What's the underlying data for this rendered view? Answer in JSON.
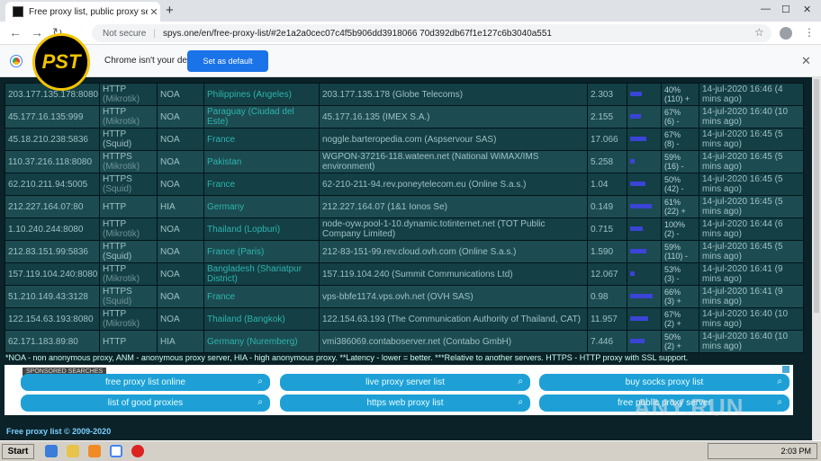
{
  "browser": {
    "tab_title": "Free proxy list, public proxy servers",
    "address": {
      "security": "Not secure",
      "url": "spys.one/en/free-proxy-list/#2e1a2a0cec07c4f5b906dd3918066 70d392db67f1e127c6b3040a551"
    },
    "infobar": {
      "message": "Chrome isn't your default browser",
      "set_default_label": "Set as default"
    }
  },
  "logo_text": "PST",
  "proxies": [
    {
      "ip": "203.177.135.178:8080",
      "type": "HTTP",
      "type_sub": "(Mikrotik)",
      "anon": "NOA",
      "country": "Philippines (Angeles)",
      "host": "203.177.135.178 (Globe Telecoms)",
      "latency": "2.303",
      "uptime": "40%",
      "uptime_sub": "(110) +",
      "checked": "14-jul-2020 16:46 (4 mins ago)"
    },
    {
      "ip": "45.177.16.135:999",
      "type": "HTTP",
      "type_sub": "(Mikrotik)",
      "anon": "NOA",
      "country": "Paraguay (Ciudad del Este)",
      "host": "45.177.16.135 (IMEX S.A.)",
      "latency": "2.155",
      "uptime": "67%",
      "uptime_sub": "(6) -",
      "checked": "14-jul-2020 16:40 (10 mins ago)"
    },
    {
      "ip": "45.18.210.238:5836",
      "type": "HTTP (Squid)",
      "type_sub": "",
      "anon": "NOA",
      "country": "France",
      "host": "noggle.barteropedia.com (Aspservour SAS)",
      "latency": "17.066",
      "uptime": "67%",
      "uptime_sub": "(8) -",
      "checked": "14-jul-2020 16:45 (5 mins ago)"
    },
    {
      "ip": "110.37.216.118:8080",
      "type": "HTTPS",
      "type_sub": "(Mikrotik)",
      "anon": "NOA",
      "country": "Pakistan",
      "host": "WGPON-37216-118.wateen.net (National WiMAX/IMS environment)",
      "latency": "5.258",
      "uptime": "59%",
      "uptime_sub": "(16) -",
      "checked": "14-jul-2020 16:45 (5 mins ago)"
    },
    {
      "ip": "62.210.211.94:5005",
      "type": "HTTPS",
      "type_sub": "(Squid)",
      "anon": "NOA",
      "country": "France",
      "host": "62-210-211-94.rev.poneytelecom.eu (Online S.a.s.)",
      "latency": "1.04",
      "uptime": "50%",
      "uptime_sub": "(42) -",
      "checked": "14-jul-2020 16:45 (5 mins ago)"
    },
    {
      "ip": "212.227.164.07:80",
      "type": "HTTP",
      "type_sub": "",
      "anon": "HIA",
      "country": "Germany",
      "host": "212.227.164.07 (1&1 Ionos Se)",
      "latency": "0.149",
      "uptime": "61%",
      "uptime_sub": "(22) +",
      "checked": "14-jul-2020 16:45 (5 mins ago)"
    },
    {
      "ip": "1.10.240.244:8080",
      "type": "HTTP",
      "type_sub": "(Mikrotik)",
      "anon": "NOA",
      "country": "Thailand (Lopburi)",
      "host": "node-oyw.pool-1-10.dynamic.totinternet.net (TOT Public Company Limited)",
      "latency": "0.715",
      "uptime": "100%",
      "uptime_sub": "(2) -",
      "checked": "14-jul-2020 16:44 (6 mins ago)"
    },
    {
      "ip": "212.83.151.99:5836",
      "type": "HTTP (Squid)",
      "type_sub": "",
      "anon": "NOA",
      "country": "France (Paris)",
      "host": "212-83-151-99.rev.cloud.ovh.com (Online S.a.s.)",
      "latency": "1.590",
      "uptime": "59%",
      "uptime_sub": "(110) -",
      "checked": "14-jul-2020 16:45 (5 mins ago)"
    },
    {
      "ip": "157.119.104.240:8080",
      "type": "HTTP",
      "type_sub": "(Mikrotik)",
      "anon": "NOA",
      "country": "Bangladesh (Shariatpur District)",
      "host": "157.119.104.240 (Summit Communications Ltd)",
      "latency": "12.067",
      "uptime": "53%",
      "uptime_sub": "(3) -",
      "checked": "14-jul-2020 16:41 (9 mins ago)"
    },
    {
      "ip": "51.210.149.43:3128",
      "type": "HTTPS",
      "type_sub": "(Squid)",
      "anon": "NOA",
      "country": "France",
      "host": "vps-bbfe1174.vps.ovh.net (OVH SAS)",
      "latency": "0.98",
      "uptime": "66%",
      "uptime_sub": "(3) +",
      "checked": "14-jul-2020 16:41 (9 mins ago)"
    },
    {
      "ip": "122.154.63.193:8080",
      "type": "HTTP",
      "type_sub": "(Mikrotik)",
      "anon": "NOA",
      "country": "Thailand (Bangkok)",
      "host": "122.154.63.193 (The Communication Authority of Thailand, CAT)",
      "latency": "11.957",
      "uptime": "67%",
      "uptime_sub": "(2) +",
      "checked": "14-jul-2020 16:40 (10 mins ago)"
    },
    {
      "ip": "62.171.183.89:80",
      "type": "HTTP",
      "type_sub": "",
      "anon": "HIA",
      "country": "Germany (Nuremberg)",
      "host": "vmi386069.contaboserver.net (Contabo GmbH)",
      "latency": "7.446",
      "uptime": "50%",
      "uptime_sub": "(2) +",
      "checked": "14-jul-2020 16:40 (10 mins ago)"
    }
  ],
  "bars": [
    0.35,
    0.3,
    0.55,
    0.05,
    0.5,
    0.75,
    0.4,
    0.55,
    0.05,
    0.8,
    0.6,
    0.45
  ],
  "legend_note": "*NOA - non anonymous proxy, ANM - anonymous proxy server, HIA - high anonymous proxy. **Latency - lower = better. ***Relative to another servers. HTTPS - HTTP proxy with SSL support.",
  "sponsored": {
    "label": "SPONSORED SEARCHES",
    "links": [
      "free proxy list online",
      "live proxy server list",
      "buy socks proxy list",
      "list of good proxies",
      "https web proxy list",
      "free public proxy server"
    ]
  },
  "footer": "Free proxy list © 2009-2020",
  "watermark": "ANY.RUN",
  "taskbar": {
    "start_label": "Start",
    "time": "2:03 PM"
  }
}
